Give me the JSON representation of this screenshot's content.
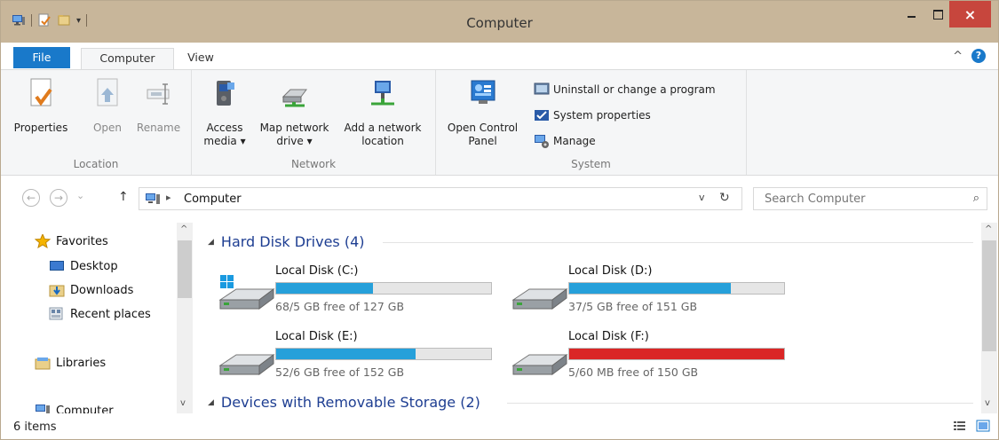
{
  "window": {
    "title": "Computer",
    "close_glyph": "×"
  },
  "ribbon_tabs": {
    "file": "File",
    "computer": "Computer",
    "view": "View",
    "help_glyph": "?",
    "collapse_glyph": "^"
  },
  "ribbon": {
    "location": {
      "label": "Location",
      "properties": "Properties",
      "open": "Open",
      "rename": "Rename"
    },
    "network": {
      "label": "Network",
      "access_media": "Access",
      "access_media_2": "media ▾",
      "map_drive": "Map network",
      "map_drive_2": "drive ▾",
      "add_location": "Add a network",
      "add_location_2": "location"
    },
    "system": {
      "label": "System",
      "open_control_panel": "Open Control",
      "open_control_panel_2": "Panel",
      "uninstall": "Uninstall or change a program",
      "system_properties": "System properties",
      "manage": "Manage"
    }
  },
  "address": {
    "location": "Computer",
    "search_placeholder": "Search Computer",
    "up_arrow": "↑",
    "crumb_sep": "▸",
    "dropdown": "v",
    "refresh": "↻",
    "search_icon": "⌕",
    "back": "←",
    "forward": "→",
    "recent": "⌄"
  },
  "nav_pane": {
    "items": [
      "Favorites",
      "Desktop",
      "Downloads",
      "Recent places",
      "Libraries",
      "Computer"
    ]
  },
  "sections": {
    "hard_disks": "Hard Disk Drives (4)",
    "removable": "Devices with Removable Storage (2)"
  },
  "drives": [
    {
      "name": "Local Disk (C:)",
      "free": "68/5 GB free of 127 GB",
      "used_fraction": 0.45,
      "color": "#26a0da"
    },
    {
      "name": "Local Disk (D:)",
      "free": "37/5 GB free of 151 GB",
      "used_fraction": 0.75,
      "color": "#26a0da"
    },
    {
      "name": "Local Disk (E:)",
      "free": "52/6 GB free of 152 GB",
      "used_fraction": 0.65,
      "color": "#26a0da"
    },
    {
      "name": "Local Disk (F:)",
      "free": "5/60 MB free of 150 GB",
      "used_fraction": 1.0,
      "color": "#da2626"
    }
  ],
  "status": {
    "items": "6 items"
  },
  "colors": {
    "accent": "#1979ca",
    "title_bar": "#c8b69a",
    "close": "#c7463d",
    "section_text": "#1e3e92"
  },
  "icons": [
    "computer-icon",
    "properties-icon",
    "folder-icon",
    "rename-icon",
    "access-media-icon",
    "map-drive-icon",
    "network-location-icon",
    "control-panel-icon",
    "uninstall-icon",
    "system-properties-icon",
    "manage-icon",
    "star-icon",
    "desktop-icon",
    "downloads-icon",
    "recent-places-icon",
    "libraries-icon",
    "hard-drive-icon",
    "windows-drive-icon",
    "details-view-icon",
    "large-icons-view-icon"
  ]
}
